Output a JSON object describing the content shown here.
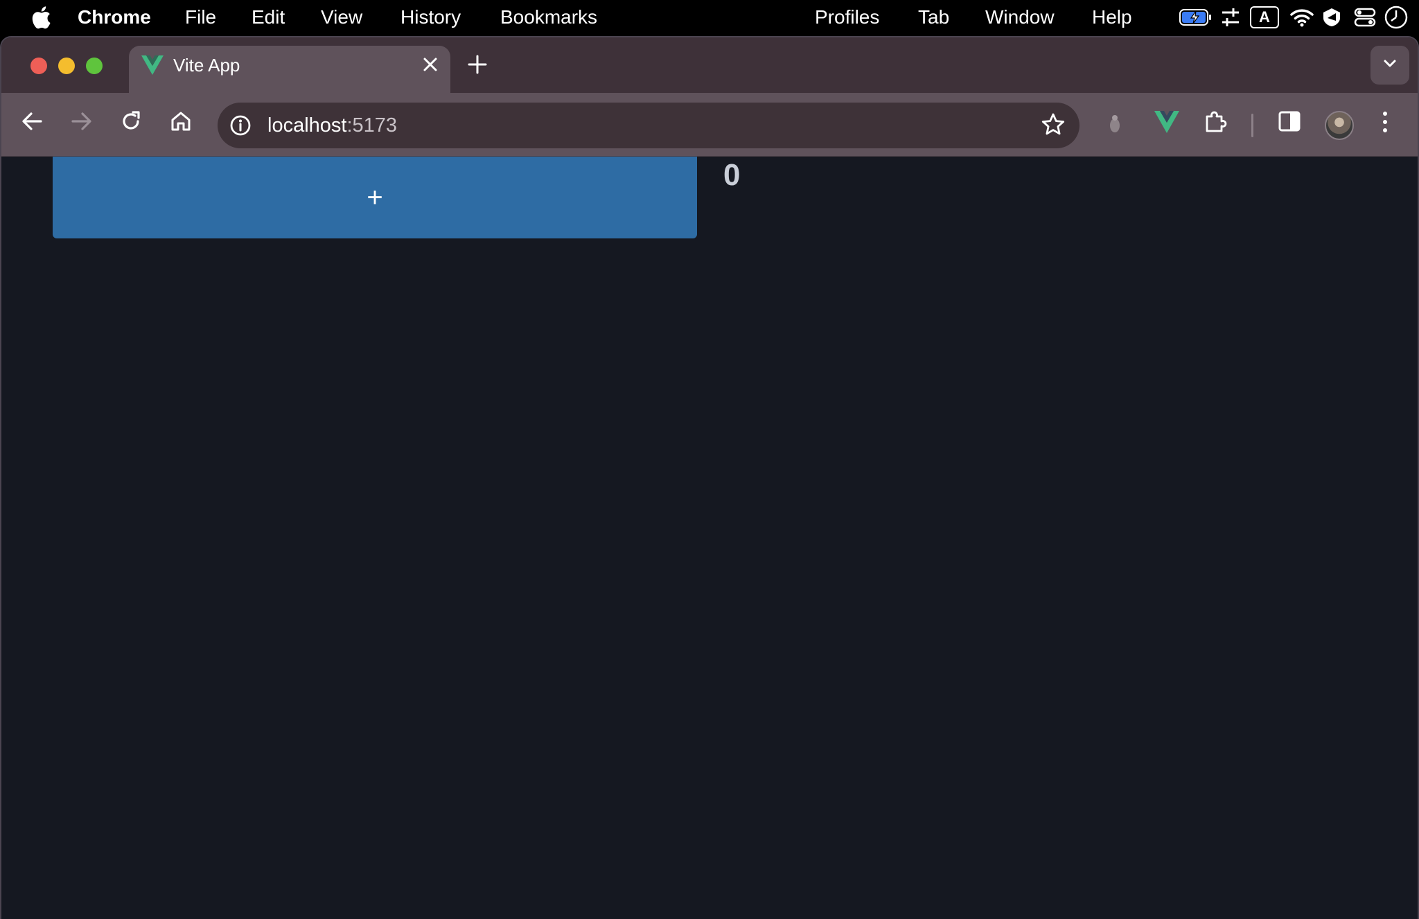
{
  "menubar": {
    "app_name": "Chrome",
    "menus": [
      "File",
      "Edit",
      "View",
      "History",
      "Bookmarks",
      "Profiles",
      "Tab",
      "Window",
      "Help"
    ],
    "input_source": "A"
  },
  "browser": {
    "tab": {
      "title": "Vite App",
      "favicon": "vue-logo-icon"
    },
    "address_bar": {
      "host": "localhost",
      "port": ":5173"
    },
    "theme_colors": {
      "tabstrip": "#3e3139",
      "toolbar": "#5f525b",
      "omnibox": "#3e3238"
    }
  },
  "page": {
    "add_button_label": "+",
    "counter_value": "0",
    "colors": {
      "background": "#151821",
      "button": "#2e6ca4",
      "counter": "#c9ced8"
    }
  }
}
